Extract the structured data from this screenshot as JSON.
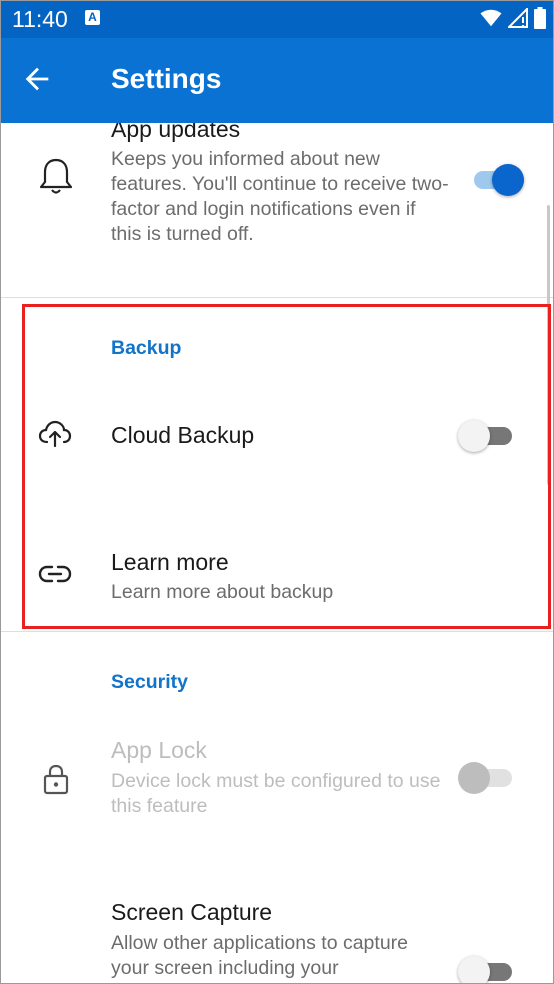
{
  "status_bar": {
    "time": "11:40",
    "notification_glyph": "A"
  },
  "app_bar": {
    "title": "Settings"
  },
  "app_updates": {
    "title": "App updates",
    "description": "Keeps you informed about new features. You'll continue to receive two-factor and login notifications even if this is turned off.",
    "enabled": true
  },
  "backup": {
    "header": "Backup",
    "cloud_backup": {
      "title": "Cloud Backup",
      "enabled": false
    },
    "learn_more": {
      "title": "Learn more",
      "subtitle": "Learn more about backup"
    }
  },
  "security": {
    "header": "Security",
    "app_lock": {
      "title": "App Lock",
      "subtitle": "Device lock must be configured to use this feature",
      "enabled": false,
      "disabled": true
    },
    "screen_capture": {
      "title": "Screen Capture",
      "subtitle": "Allow other applications to capture your screen including your",
      "enabled": false
    }
  },
  "colors": {
    "status_bar": "#0464c4",
    "app_bar": "#0a72d2",
    "accent": "#1173c9",
    "highlight": "#e8201f"
  },
  "icons": [
    "back-arrow-icon",
    "bell-icon",
    "cloud-upload-icon",
    "link-icon",
    "lock-icon",
    "wifi-icon",
    "signal-icon",
    "battery-icon"
  ]
}
